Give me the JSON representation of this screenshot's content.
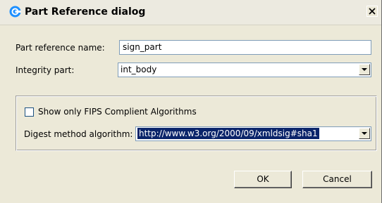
{
  "window": {
    "title": "Part Reference dialog"
  },
  "form": {
    "part_reference_label": "Part reference name:",
    "part_reference_value": "sign_part",
    "integrity_label": "Integrity part:",
    "integrity_value": "int_body"
  },
  "algorithms": {
    "fips_checkbox_label": "Show only FIPS Complient Algorithms",
    "fips_checked": false,
    "digest_label": "Digest method algorithm:",
    "digest_value": "http://www.w3.org/2000/09/xmldsig#sha1"
  },
  "buttons": {
    "ok_label": "OK",
    "cancel_label": "Cancel"
  },
  "icons": {
    "app": "eclipse-app-icon",
    "close": "close-icon",
    "dropdown": "chevron-down-icon"
  },
  "colors": {
    "dialog_background": "#ece9d8",
    "field_border": "#7f9db9",
    "selection_background": "#0a246a",
    "app_icon_blue": "#1e90ff"
  }
}
